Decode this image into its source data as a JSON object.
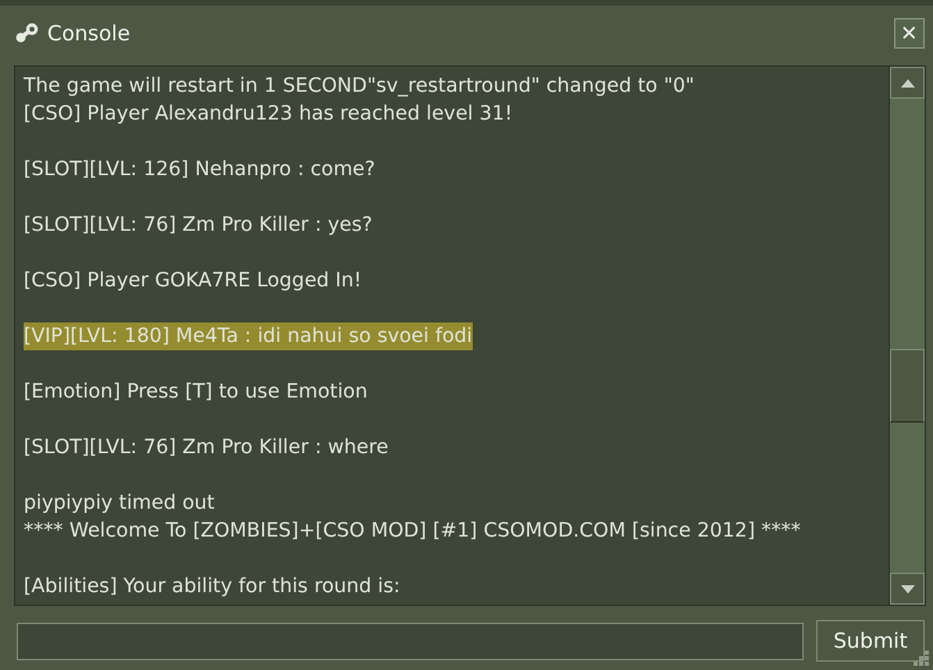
{
  "window": {
    "title": "Console",
    "close": "✕"
  },
  "console": {
    "blocks": [
      {
        "lines": [
          {
            "text": "The game will restart in 1 SECOND\"sv_restartround\" changed to \"0\"",
            "highlighted": false
          },
          {
            "text": "[CSO] Player Alexandru123 has reached level 31!",
            "highlighted": false
          }
        ]
      },
      {
        "lines": [
          {
            "text": "[SLOT][LVL: 126] Nehanpro : come?",
            "highlighted": false
          }
        ]
      },
      {
        "lines": [
          {
            "text": "[SLOT][LVL: 76] Zm Pro Killer : yes?",
            "highlighted": false
          }
        ]
      },
      {
        "lines": [
          {
            "text": "[CSO] Player GOKA7RE Logged In!",
            "highlighted": false
          }
        ]
      },
      {
        "lines": [
          {
            "text": "[VIP][LVL: 180] Me4Ta : idi nahui so svoei fodi",
            "highlighted": true
          }
        ]
      },
      {
        "lines": [
          {
            "text": "[Emotion] Press [T] to use Emotion",
            "highlighted": false
          }
        ]
      },
      {
        "lines": [
          {
            "text": "[SLOT][LVL: 76] Zm Pro Killer : where",
            "highlighted": false
          }
        ]
      },
      {
        "lines": [
          {
            "text": "piypiypiy timed out",
            "highlighted": false
          },
          {
            "text": "**** Welcome To [ZOMBIES]+[CSO MOD] [#1] CSOMOD.COM [since 2012] ****",
            "highlighted": false
          }
        ]
      },
      {
        "lines": [
          {
            "text": "[Abilities] Your ability for this round is:",
            "highlighted": false
          }
        ]
      }
    ]
  },
  "submit": {
    "label": "Submit"
  }
}
